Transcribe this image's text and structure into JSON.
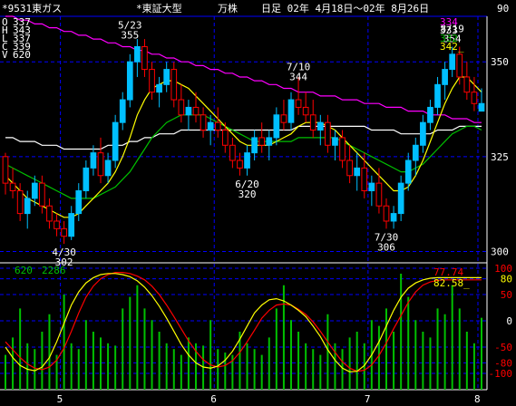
{
  "header": {
    "code_name": "*9531東ガス",
    "market": "*東証大型",
    "unit": "万株",
    "period_label": "日足 02年 4月18日～02年 8月26日",
    "bar_count": "90"
  },
  "ohlcv_readout": [
    {
      "label": "O",
      "value": "337"
    },
    {
      "label": "H",
      "value": "343"
    },
    {
      "label": "L",
      "value": "337"
    },
    {
      "label": "C",
      "value": "339"
    },
    {
      "label": "V",
      "value": "620"
    }
  ],
  "ma_readout": [
    {
      "value": "334",
      "color": "#ff00ff"
    },
    {
      "value": "333",
      "color": "#ffffff"
    },
    {
      "value": "332",
      "color": "#00c000"
    },
    {
      "value": "342_",
      "color": "#ffff00"
    }
  ],
  "colors": {
    "background": "#000000",
    "grid": "#0000ff",
    "up_candle": "#00bfff",
    "down_candle": "#ff0000",
    "ma_short": "#ffff00",
    "ma_mid": "#00c000",
    "ma_long": "#ffffff",
    "ma_longest": "#ff00ff",
    "volume": "#00c000",
    "osc_fast": "#ffff00",
    "osc_slow": "#ff0000",
    "text": "#ffffff",
    "osc_fast_text": "#ffff00",
    "osc_slow_text": "#ff0000"
  },
  "chart_data": {
    "type": "candlestick",
    "price_axis": {
      "ticks": [
        "350",
        "325",
        "300"
      ],
      "ylim": [
        297,
        362
      ]
    },
    "x_month_labels": [
      "5",
      "6",
      "7",
      "8"
    ],
    "annotations": [
      {
        "date": "4/30",
        "value": "302",
        "kind": "low"
      },
      {
        "date": "5/23",
        "value": "355",
        "kind": "high"
      },
      {
        "date": "6/20",
        "value": "320",
        "kind": "low"
      },
      {
        "date": "7/10",
        "value": "344",
        "kind": "high"
      },
      {
        "date": "7/30",
        "value": "306",
        "kind": "low"
      },
      {
        "date": "8/19",
        "value": "354",
        "kind": "high"
      }
    ],
    "candles": [
      [
        325,
        326,
        315,
        318
      ],
      [
        318,
        322,
        314,
        316
      ],
      [
        316,
        318,
        308,
        310
      ],
      [
        310,
        316,
        306,
        314
      ],
      [
        314,
        320,
        312,
        318
      ],
      [
        318,
        320,
        310,
        312
      ],
      [
        312,
        314,
        306,
        308
      ],
      [
        308,
        310,
        304,
        306
      ],
      [
        306,
        308,
        302,
        304
      ],
      [
        304,
        312,
        303,
        310
      ],
      [
        310,
        318,
        308,
        316
      ],
      [
        316,
        324,
        314,
        322
      ],
      [
        322,
        328,
        320,
        326
      ],
      [
        326,
        330,
        318,
        320
      ],
      [
        320,
        326,
        318,
        324
      ],
      [
        324,
        336,
        322,
        334
      ],
      [
        334,
        342,
        332,
        340
      ],
      [
        340,
        352,
        338,
        350
      ],
      [
        350,
        356,
        346,
        354
      ],
      [
        354,
        356,
        346,
        348
      ],
      [
        348,
        350,
        340,
        342
      ],
      [
        342,
        346,
        338,
        344
      ],
      [
        344,
        350,
        342,
        348
      ],
      [
        348,
        350,
        338,
        340
      ],
      [
        340,
        344,
        334,
        336
      ],
      [
        336,
        340,
        332,
        338
      ],
      [
        338,
        342,
        334,
        336
      ],
      [
        336,
        338,
        330,
        332
      ],
      [
        332,
        336,
        328,
        334
      ],
      [
        334,
        338,
        330,
        332
      ],
      [
        332,
        334,
        326,
        328
      ],
      [
        328,
        330,
        322,
        324
      ],
      [
        324,
        326,
        320,
        322
      ],
      [
        322,
        328,
        320,
        326
      ],
      [
        326,
        332,
        324,
        330
      ],
      [
        330,
        334,
        326,
        328
      ],
      [
        328,
        332,
        324,
        330
      ],
      [
        330,
        338,
        328,
        336
      ],
      [
        336,
        340,
        332,
        334
      ],
      [
        334,
        342,
        332,
        340
      ],
      [
        340,
        346,
        336,
        338
      ],
      [
        338,
        342,
        334,
        336
      ],
      [
        336,
        340,
        330,
        332
      ],
      [
        332,
        336,
        328,
        334
      ],
      [
        334,
        336,
        326,
        328
      ],
      [
        328,
        332,
        324,
        330
      ],
      [
        330,
        332,
        322,
        324
      ],
      [
        324,
        328,
        318,
        320
      ],
      [
        320,
        326,
        316,
        322
      ],
      [
        322,
        326,
        314,
        316
      ],
      [
        316,
        320,
        312,
        318
      ],
      [
        318,
        322,
        310,
        312
      ],
      [
        312,
        314,
        306,
        308
      ],
      [
        308,
        312,
        306,
        310
      ],
      [
        310,
        320,
        308,
        318
      ],
      [
        318,
        326,
        316,
        324
      ],
      [
        324,
        330,
        320,
        328
      ],
      [
        328,
        336,
        326,
        334
      ],
      [
        334,
        340,
        332,
        338
      ],
      [
        338,
        346,
        336,
        344
      ],
      [
        344,
        350,
        340,
        348
      ],
      [
        348,
        354,
        346,
        352
      ],
      [
        352,
        354,
        344,
        346
      ],
      [
        346,
        350,
        340,
        342
      ],
      [
        342,
        346,
        337,
        339
      ],
      [
        337,
        343,
        337,
        339
      ]
    ],
    "ma_short": [
      320,
      318,
      316,
      314,
      313,
      312,
      311,
      310,
      309,
      309,
      310,
      312,
      314,
      316,
      318,
      321,
      325,
      330,
      336,
      340,
      343,
      344,
      345,
      345,
      344,
      343,
      341,
      339,
      337,
      335,
      333,
      331,
      329,
      328,
      328,
      328,
      328,
      329,
      330,
      331,
      333,
      334,
      334,
      334,
      333,
      332,
      330,
      328,
      326,
      324,
      322,
      320,
      318,
      316,
      316,
      317,
      320,
      324,
      329,
      334,
      339,
      343,
      346,
      346,
      344,
      342
    ],
    "ma_mid": [
      323,
      322,
      321,
      320,
      319,
      318,
      317,
      316,
      315,
      314,
      314,
      314,
      314,
      315,
      316,
      317,
      319,
      321,
      324,
      327,
      330,
      332,
      334,
      335,
      336,
      336,
      336,
      336,
      335,
      334,
      333,
      332,
      331,
      330,
      329,
      329,
      329,
      329,
      329,
      329,
      330,
      330,
      330,
      330,
      330,
      330,
      329,
      328,
      327,
      326,
      325,
      324,
      323,
      322,
      321,
      321,
      322,
      323,
      325,
      327,
      329,
      331,
      332,
      333,
      333,
      332
    ],
    "ma_long": [
      330,
      330,
      329,
      329,
      329,
      328,
      328,
      328,
      327,
      327,
      327,
      327,
      327,
      327,
      328,
      328,
      328,
      329,
      329,
      330,
      330,
      331,
      331,
      331,
      332,
      332,
      332,
      332,
      332,
      332,
      332,
      332,
      332,
      332,
      332,
      332,
      332,
      332,
      332,
      332,
      333,
      333,
      333,
      333,
      333,
      333,
      333,
      333,
      333,
      333,
      332,
      332,
      332,
      332,
      331,
      331,
      331,
      331,
      331,
      332,
      332,
      332,
      333,
      333,
      333,
      333
    ],
    "ma_longest": [
      362,
      362,
      361,
      361,
      360,
      360,
      359,
      359,
      358,
      358,
      357,
      357,
      356,
      356,
      355,
      355,
      354,
      354,
      353,
      353,
      352,
      352,
      351,
      351,
      350,
      350,
      349,
      349,
      348,
      348,
      347,
      347,
      346,
      346,
      345,
      345,
      344,
      344,
      343,
      343,
      342,
      342,
      342,
      341,
      341,
      341,
      340,
      340,
      340,
      339,
      339,
      339,
      338,
      338,
      338,
      337,
      337,
      337,
      336,
      336,
      336,
      335,
      335,
      335,
      334,
      334
    ],
    "volume": [
      300,
      450,
      700,
      400,
      350,
      500,
      650,
      300,
      820,
      400,
      350,
      600,
      500,
      450,
      400,
      380,
      700,
      800,
      900,
      700,
      600,
      500,
      400,
      350,
      300,
      450,
      400,
      380,
      600,
      350,
      320,
      300,
      500,
      400,
      350,
      300,
      450,
      700,
      900,
      600,
      500,
      400,
      350,
      300,
      650,
      400,
      350,
      450,
      500,
      400,
      600,
      550,
      700,
      500,
      1000,
      800,
      600,
      500,
      450,
      700,
      650,
      900,
      700,
      500,
      400,
      620
    ],
    "volume_readout": {
      "current": "620",
      "average": "2286"
    },
    "osc_axis": {
      "ticks": [
        "100",
        "80",
        "50",
        "0",
        "-50",
        "-80",
        "-100"
      ],
      "ylim": [
        -100,
        100
      ]
    },
    "osc_fast": [
      -50,
      -70,
      -85,
      -92,
      -95,
      -88,
      -70,
      -40,
      -5,
      30,
      55,
      72,
      82,
      88,
      90,
      90,
      88,
      84,
      76,
      64,
      48,
      28,
      5,
      -20,
      -45,
      -65,
      -80,
      -88,
      -90,
      -86,
      -75,
      -58,
      -35,
      -10,
      15,
      30,
      40,
      42,
      38,
      30,
      20,
      8,
      -10,
      -30,
      -55,
      -75,
      -90,
      -97,
      -96,
      -85,
      -65,
      -40,
      -10,
      20,
      45,
      62,
      72,
      78,
      81,
      82,
      82,
      82,
      82,
      82,
      82,
      82
    ],
    "osc_slow": [
      -40,
      -55,
      -70,
      -82,
      -90,
      -93,
      -88,
      -75,
      -52,
      -20,
      15,
      45,
      66,
      80,
      88,
      92,
      92,
      90,
      85,
      78,
      66,
      50,
      30,
      8,
      -15,
      -38,
      -58,
      -74,
      -84,
      -88,
      -85,
      -76,
      -60,
      -40,
      -18,
      5,
      20,
      30,
      32,
      30,
      22,
      12,
      -2,
      -20,
      -40,
      -60,
      -78,
      -90,
      -96,
      -94,
      -84,
      -66,
      -42,
      -15,
      10,
      35,
      55,
      68,
      74,
      77,
      78,
      78,
      78,
      78,
      78,
      78
    ],
    "osc_readout": {
      "slow": "77.74",
      "fast": "82.58_"
    }
  }
}
